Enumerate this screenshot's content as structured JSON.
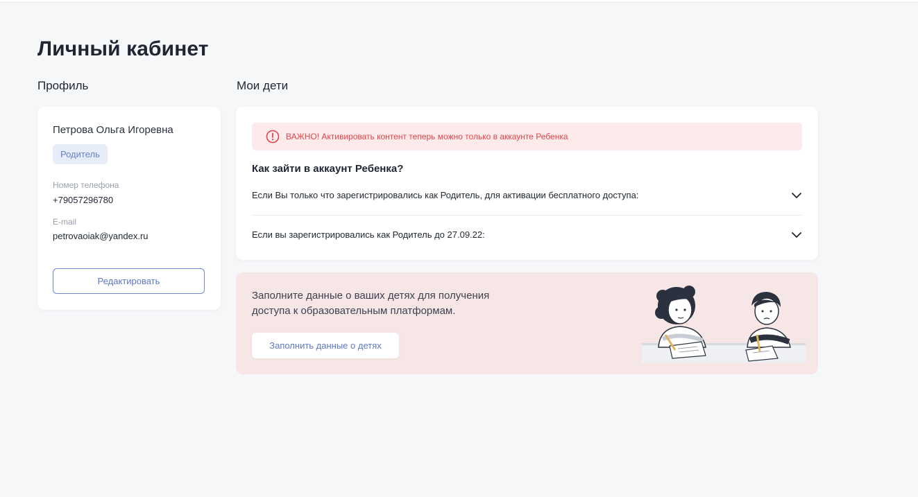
{
  "page": {
    "title": "Личный кабинет"
  },
  "profile": {
    "section_title": "Профиль",
    "name": "Петрова Ольга Игоревна",
    "role": "Родитель",
    "phone_label": "Номер телефона",
    "phone": "+79057296780",
    "email_label": "E-mail",
    "email": "petrovaoiak@yandex.ru",
    "edit_label": "Редактировать"
  },
  "children": {
    "section_title": "Мои дети",
    "alert": {
      "text": "ВАЖНО! Активировать контент теперь можно только в аккаунте Ребенка",
      "icon": "alert-circle-icon",
      "color": "#e4444a"
    },
    "how_to_heading": "Как зайти в аккаунт Ребенка?",
    "accordion": [
      {
        "text": "Если Вы только что зарегистрировались как Родитель, для активации бесплатного доступа:",
        "icon": "chevron-down-icon"
      },
      {
        "text": "Если вы зарегистрировались как Родитель до 27.09.22:",
        "icon": "chevron-down-icon"
      }
    ],
    "promo": {
      "text": "Заполните данные о ваших детях для получения доступа к образовательным платформам.",
      "button_label": "Заполнить данные о детях",
      "illustration": "children-studying-illustration"
    }
  },
  "colors": {
    "background": "#f6f7f9",
    "card": "#ffffff",
    "accent": "#5f77c6",
    "badge_bg": "#e7ecf9",
    "alert_bg": "#fdeaea",
    "promo_bg": "#f7e6e6"
  }
}
